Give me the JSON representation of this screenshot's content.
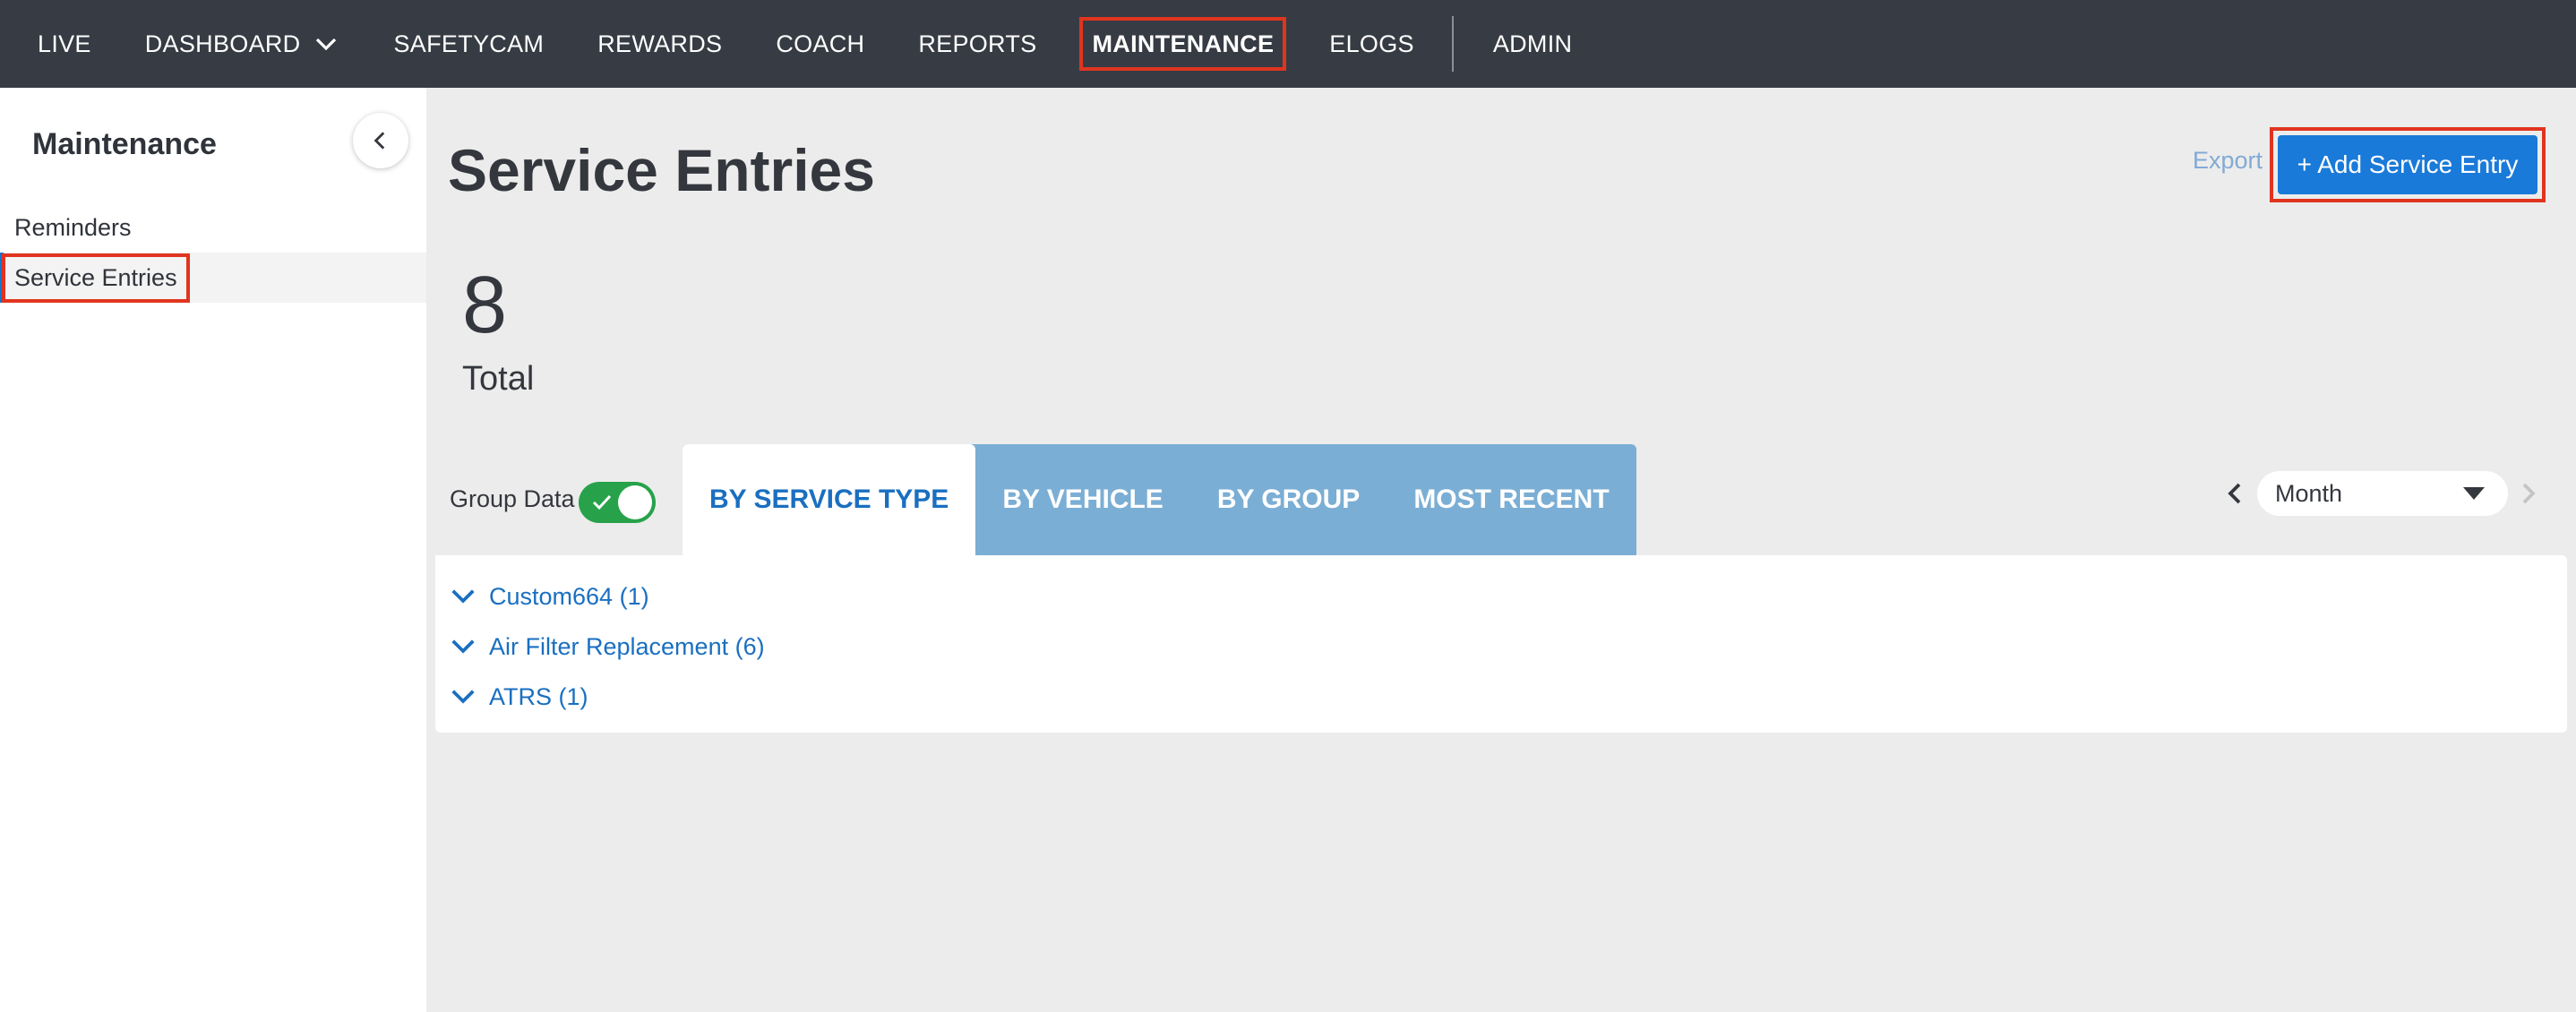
{
  "nav": {
    "items": [
      {
        "label": "LIVE"
      },
      {
        "label": "DASHBOARD"
      },
      {
        "label": "SAFETYCAM"
      },
      {
        "label": "REWARDS"
      },
      {
        "label": "COACH"
      },
      {
        "label": "REPORTS"
      },
      {
        "label": "MAINTENANCE"
      },
      {
        "label": "ELOGS"
      },
      {
        "label": "ADMIN"
      }
    ]
  },
  "sidebar": {
    "title": "Maintenance",
    "items": [
      {
        "label": "Reminders"
      },
      {
        "label": "Service Entries"
      }
    ]
  },
  "main": {
    "title": "Service Entries",
    "export_label": "Export",
    "add_label": "+ Add Service Entry",
    "total": {
      "value": "8",
      "label": "Total"
    },
    "group_data_label": "Group Data",
    "group_data_on": true,
    "tabs": [
      {
        "label": "BY SERVICE TYPE",
        "active": true
      },
      {
        "label": "BY VEHICLE",
        "active": false
      },
      {
        "label": "BY GROUP",
        "active": false
      },
      {
        "label": "MOST RECENT",
        "active": false
      }
    ],
    "period": {
      "selected": "Month"
    },
    "groups": [
      {
        "label": "Custom664 (1)"
      },
      {
        "label": "Air Filter Replacement (6)"
      },
      {
        "label": "ATRS (1)"
      }
    ]
  },
  "colors": {
    "nav_bg": "#373b43",
    "accent": "#1a7ad9",
    "tab_bar": "#7baed4",
    "toggle_on": "#27a24a",
    "highlight": "#e0341f"
  }
}
